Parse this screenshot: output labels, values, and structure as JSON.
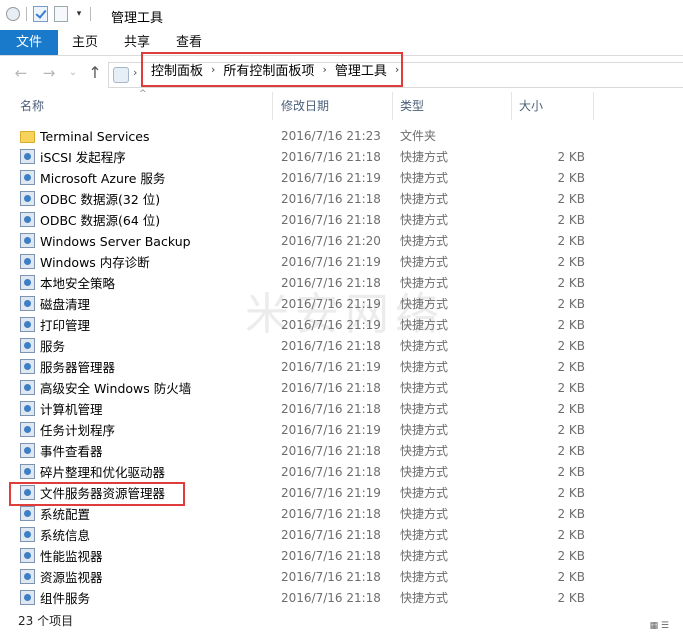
{
  "window": {
    "title": "管理工具"
  },
  "ribbon": {
    "tabs": [
      "文件",
      "主页",
      "共享",
      "查看"
    ]
  },
  "nav": {
    "back": "←",
    "forward": "→",
    "dropdown": "⌄",
    "up": "↑"
  },
  "address": {
    "crumbs": [
      "控制面板",
      "所有控制面板项",
      "管理工具"
    ],
    "separator": "›"
  },
  "columns": {
    "name": "名称",
    "modified": "修改日期",
    "type": "类型",
    "size": "大小"
  },
  "files": [
    {
      "name": "Terminal Services",
      "modified": "2016/7/16 21:23",
      "type": "文件夹",
      "size": "",
      "icon": "folder-icon"
    },
    {
      "name": "iSCSI 发起程序",
      "modified": "2016/7/16 21:18",
      "type": "快捷方式",
      "size": "2 KB",
      "icon": "iscsi-icon"
    },
    {
      "name": "Microsoft Azure 服务",
      "modified": "2016/7/16 21:19",
      "type": "快捷方式",
      "size": "2 KB",
      "icon": "azure-icon"
    },
    {
      "name": "ODBC 数据源(32 位)",
      "modified": "2016/7/16 21:18",
      "type": "快捷方式",
      "size": "2 KB",
      "icon": "odbc-icon"
    },
    {
      "name": "ODBC 数据源(64 位)",
      "modified": "2016/7/16 21:18",
      "type": "快捷方式",
      "size": "2 KB",
      "icon": "odbc-icon"
    },
    {
      "name": "Windows Server Backup",
      "modified": "2016/7/16 21:20",
      "type": "快捷方式",
      "size": "2 KB",
      "icon": "backup-icon"
    },
    {
      "name": "Windows 内存诊断",
      "modified": "2016/7/16 21:19",
      "type": "快捷方式",
      "size": "2 KB",
      "icon": "memory-diagnostic-icon"
    },
    {
      "name": "本地安全策略",
      "modified": "2016/7/16 21:18",
      "type": "快捷方式",
      "size": "2 KB",
      "icon": "security-policy-icon"
    },
    {
      "name": "磁盘清理",
      "modified": "2016/7/16 21:19",
      "type": "快捷方式",
      "size": "2 KB",
      "icon": "disk-cleanup-icon"
    },
    {
      "name": "打印管理",
      "modified": "2016/7/16 21:19",
      "type": "快捷方式",
      "size": "2 KB",
      "icon": "print-management-icon"
    },
    {
      "name": "服务",
      "modified": "2016/7/16 21:18",
      "type": "快捷方式",
      "size": "2 KB",
      "icon": "services-icon"
    },
    {
      "name": "服务器管理器",
      "modified": "2016/7/16 21:19",
      "type": "快捷方式",
      "size": "2 KB",
      "icon": "server-manager-icon"
    },
    {
      "name": "高级安全 Windows 防火墙",
      "modified": "2016/7/16 21:18",
      "type": "快捷方式",
      "size": "2 KB",
      "icon": "firewall-icon"
    },
    {
      "name": "计算机管理",
      "modified": "2016/7/16 21:18",
      "type": "快捷方式",
      "size": "2 KB",
      "icon": "computer-management-icon"
    },
    {
      "name": "任务计划程序",
      "modified": "2016/7/16 21:19",
      "type": "快捷方式",
      "size": "2 KB",
      "icon": "task-scheduler-icon"
    },
    {
      "name": "事件查看器",
      "modified": "2016/7/16 21:18",
      "type": "快捷方式",
      "size": "2 KB",
      "icon": "event-viewer-icon"
    },
    {
      "name": "碎片整理和优化驱动器",
      "modified": "2016/7/16 21:18",
      "type": "快捷方式",
      "size": "2 KB",
      "icon": "defrag-icon"
    },
    {
      "name": "文件服务器资源管理器",
      "modified": "2016/7/16 21:19",
      "type": "快捷方式",
      "size": "2 KB",
      "icon": "file-server-resource-manager-icon"
    },
    {
      "name": "系统配置",
      "modified": "2016/7/16 21:18",
      "type": "快捷方式",
      "size": "2 KB",
      "icon": "system-config-icon"
    },
    {
      "name": "系统信息",
      "modified": "2016/7/16 21:18",
      "type": "快捷方式",
      "size": "2 KB",
      "icon": "system-info-icon"
    },
    {
      "name": "性能监视器",
      "modified": "2016/7/16 21:18",
      "type": "快捷方式",
      "size": "2 KB",
      "icon": "performance-monitor-icon"
    },
    {
      "name": "资源监视器",
      "modified": "2016/7/16 21:18",
      "type": "快捷方式",
      "size": "2 KB",
      "icon": "resource-monitor-icon"
    },
    {
      "name": "组件服务",
      "modified": "2016/7/16 21:18",
      "type": "快捷方式",
      "size": "2 KB",
      "icon": "component-services-icon"
    }
  ],
  "highlighted_item": "文件服务器资源管理器",
  "watermark": "米安网络",
  "status": {
    "count": "23 个项目"
  },
  "colors": {
    "accent": "#1979ca",
    "highlight": "#e03c3c"
  }
}
